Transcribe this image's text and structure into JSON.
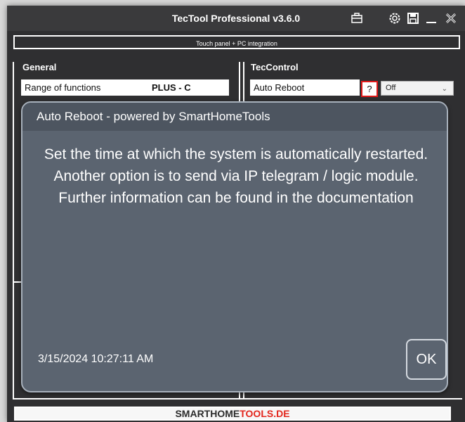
{
  "window": {
    "title": "TecTool Professional v3.6.0"
  },
  "subtitle": "Touch panel + PC integration",
  "general": {
    "heading": "General",
    "range_label": "Range of functions",
    "range_value": "PLUS - C"
  },
  "teccontrol": {
    "heading": "TecControl",
    "auto_reboot_label": "Auto Reboot",
    "help_label": "?",
    "select_value": "Off"
  },
  "modal": {
    "title": "Auto Reboot - powered by SmartHomeTools",
    "message": "Set the time at which the system is automatically restarted. Another option is to send via IP telegram / logic module. Further information can be found in the documentation",
    "timestamp": "3/15/2024 10:27:11 AM",
    "ok_label": "OK"
  },
  "footer": {
    "brand_part1": "SMARTHOME",
    "brand_part2": "TOOLS.DE"
  },
  "icons": [
    "toolbox-icon",
    "gear-icon",
    "save-icon",
    "minimize-icon",
    "close-icon",
    "chevron-down-icon"
  ],
  "colors": {
    "highlight": "#e11a1a",
    "modal_bg": "#5b6470",
    "window_bg": "#2f2f31"
  }
}
